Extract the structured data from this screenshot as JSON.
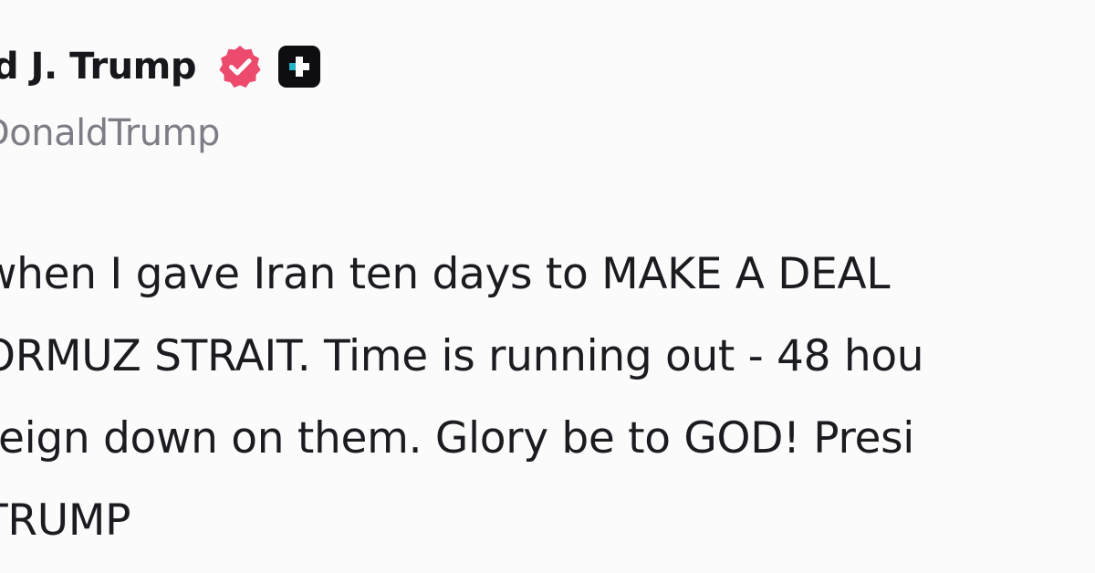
{
  "post": {
    "author_name": "d J. Trump",
    "author_handle": "DonaldTrump",
    "icons": {
      "verified": "verified-badge-icon",
      "plus": "plus-badge-icon"
    },
    "colors": {
      "verified": "#ec4b6e",
      "plus": "#0d0d12",
      "handle": "#7d7d86",
      "text": "#1b1b20"
    },
    "lines": [
      " when I gave Iran ten days to MAKE A DEAL",
      "ORMUZ STRAIT. Time is running out - 48 hou",
      "reign down on them. Glory be to GOD! Presi",
      " TRUMP"
    ]
  }
}
